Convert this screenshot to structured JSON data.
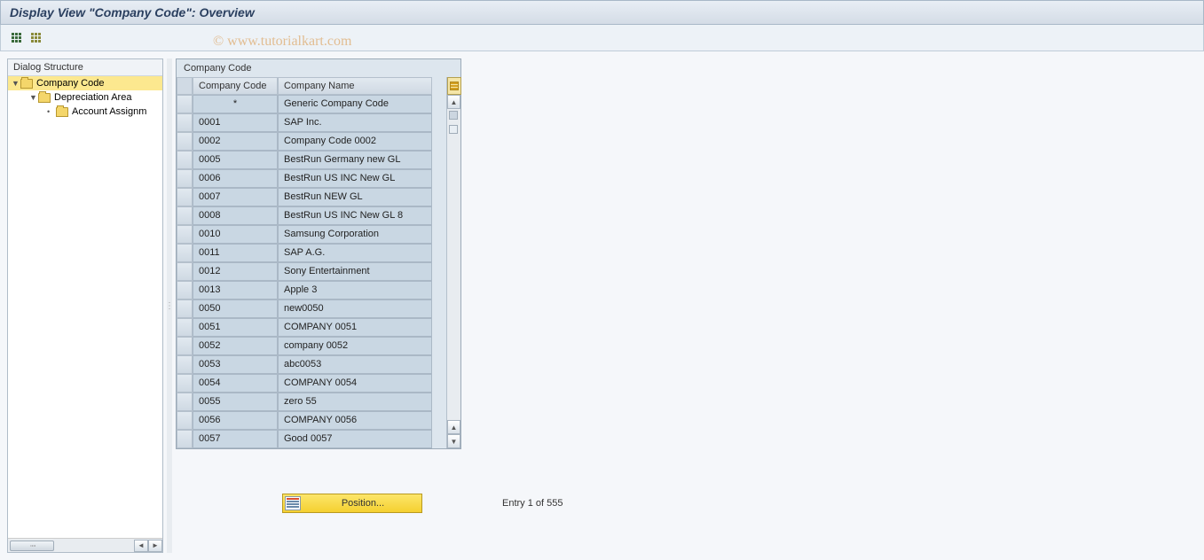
{
  "title": "Display View \"Company Code\": Overview",
  "watermark": "© www.tutorialkart.com",
  "dialog_structure": {
    "header": "Dialog Structure",
    "items": [
      {
        "label": "Company Code",
        "selected": true,
        "indent": 0,
        "expandable": true
      },
      {
        "label": "Depreciation Area",
        "selected": false,
        "indent": 1,
        "expandable": true
      },
      {
        "label": "Account Assignm",
        "selected": false,
        "indent": 2,
        "expandable": false
      }
    ]
  },
  "table": {
    "title": "Company Code",
    "columns": [
      "Company Code",
      "Company Name"
    ],
    "rows": [
      {
        "code": "*",
        "name": "Generic Company Code"
      },
      {
        "code": "0001",
        "name": "SAP Inc."
      },
      {
        "code": "0002",
        "name": "Company Code 0002"
      },
      {
        "code": "0005",
        "name": "BestRun Germany new GL"
      },
      {
        "code": "0006",
        "name": "BestRun US INC New GL"
      },
      {
        "code": "0007",
        "name": "BestRun NEW GL"
      },
      {
        "code": "0008",
        "name": "BestRun US INC New GL 8"
      },
      {
        "code": "0010",
        "name": "Samsung Corporation"
      },
      {
        "code": "0011",
        "name": "SAP A.G."
      },
      {
        "code": "0012",
        "name": "Sony Entertainment"
      },
      {
        "code": "0013",
        "name": "Apple 3"
      },
      {
        "code": "0050",
        "name": "new0050"
      },
      {
        "code": "0051",
        "name": "COMPANY 0051"
      },
      {
        "code": "0052",
        "name": "company 0052"
      },
      {
        "code": "0053",
        "name": "abc0053"
      },
      {
        "code": "0054",
        "name": "COMPANY 0054"
      },
      {
        "code": "0055",
        "name": "zero 55"
      },
      {
        "code": "0056",
        "name": "COMPANY 0056"
      },
      {
        "code": "0057",
        "name": "Good 0057"
      }
    ]
  },
  "footer": {
    "position_button": "Position...",
    "entry_text": "Entry 1 of 555"
  }
}
